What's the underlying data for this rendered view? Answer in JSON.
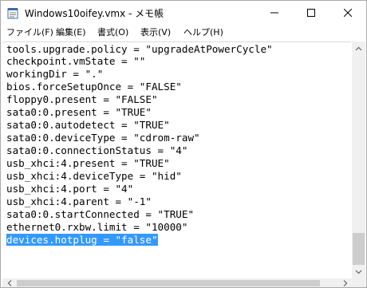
{
  "window": {
    "title": "Windows10oifey.vmx - メモ帳"
  },
  "menu": {
    "items": [
      "ファイル(F)",
      "編集(E)",
      "書式(O)",
      "表示(V)",
      "ヘルプ(H)"
    ]
  },
  "editor": {
    "lines": [
      "tools.upgrade.policy = \"upgradeAtPowerCycle\"",
      "checkpoint.vmState = \"\"",
      "workingDir = \".\"",
      "bios.forceSetupOnce = \"FALSE\"",
      "floppy0.present = \"FALSE\"",
      "sata0:0.present = \"TRUE\"",
      "sata0:0.autodetect = \"TRUE\"",
      "sata0:0.deviceType = \"cdrom-raw\"",
      "sata0:0.connectionStatus = \"4\"",
      "usb_xhci:4.present = \"TRUE\"",
      "usb_xhci:4.deviceType = \"hid\"",
      "usb_xhci:4.port = \"4\"",
      "usb_xhci:4.parent = \"-1\"",
      "sata0:0.startConnected = \"TRUE\"",
      "ethernet0.rxbw.limit = \"10000\"",
      "devices.hotplug = \"false\""
    ],
    "selected_line": "devices.hotplug = \"false\""
  },
  "icons": {
    "app": "notepad-icon",
    "minimize": "minimize-icon",
    "maximize": "maximize-icon",
    "close": "close-icon"
  },
  "colors": {
    "selection": "#3399ff",
    "scrollbar_track": "#f0f0f0",
    "scrollbar_thumb": "#cdcdcd"
  }
}
